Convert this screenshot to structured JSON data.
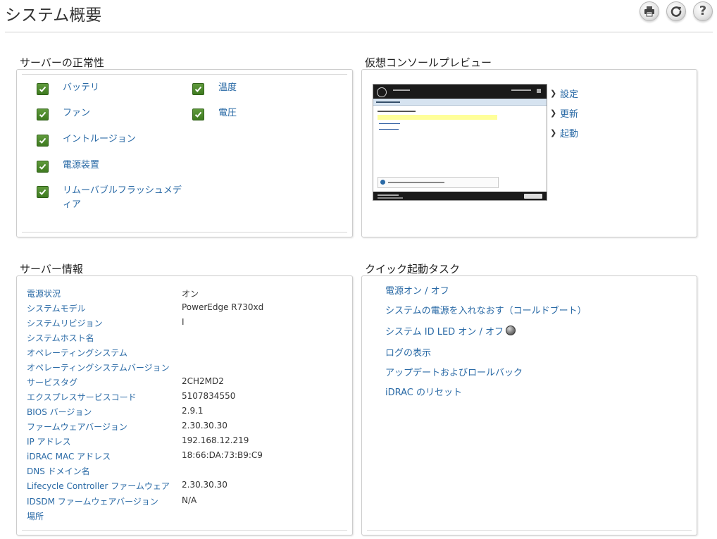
{
  "page": {
    "title": "システム概要"
  },
  "toolbar": {
    "help_label": "?"
  },
  "health": {
    "title": "サーバーの正常性",
    "items": [
      {
        "label": "バッテリ",
        "status": "ok"
      },
      {
        "label": "ファン",
        "status": "ok"
      },
      {
        "label": "イントルージョン",
        "status": "ok"
      },
      {
        "label": "電源装置",
        "status": "ok"
      },
      {
        "label": "リムーバブルフラッシュメディア",
        "status": "ok"
      },
      {
        "label": "温度",
        "status": "ok"
      },
      {
        "label": "電圧",
        "status": "ok"
      }
    ]
  },
  "console": {
    "title": "仮想コンソールプレビュー",
    "actions": [
      {
        "label": "設定"
      },
      {
        "label": "更新"
      },
      {
        "label": "起動"
      }
    ]
  },
  "server_info": {
    "title": "サーバー情報",
    "rows": [
      {
        "label": "電源状況",
        "value": "オン"
      },
      {
        "label": "システムモデル",
        "value": "PowerEdge R730xd"
      },
      {
        "label": "システムリビジョン",
        "value": "I"
      },
      {
        "label": "システムホスト名",
        "value": ""
      },
      {
        "label": "オペレーティングシステム",
        "value": ""
      },
      {
        "label": "オペレーティングシステムバージョン",
        "value": ""
      },
      {
        "label": "サービスタグ",
        "value": "2CH2MD2"
      },
      {
        "label": "エクスプレスサービスコード",
        "value": "5107834550"
      },
      {
        "label": "BIOS バージョン",
        "value": "2.9.1"
      },
      {
        "label": "ファームウェアバージョン",
        "value": "2.30.30.30"
      },
      {
        "label": "IP アドレス",
        "value": "192.168.12.219"
      },
      {
        "label": "iDRAC MAC アドレス",
        "value": "18:66:DA:73:B9:C9"
      },
      {
        "label": "DNS ドメイン名",
        "value": ""
      },
      {
        "label": "Lifecycle Controller ファームウェア",
        "value": "2.30.30.30"
      },
      {
        "label": "IDSDM ファームウェアバージョン",
        "value": "N/A"
      },
      {
        "label": "場所",
        "value": ""
      }
    ]
  },
  "quick_tasks": {
    "title": "クイック起動タスク",
    "items": [
      {
        "label": "電源オン / オフ"
      },
      {
        "label": "システムの電源を入れなおす（コールドブート）"
      },
      {
        "label": "システム ID LED オン / オフ"
      },
      {
        "label": "ログの表示"
      },
      {
        "label": "アップデートおよびロールバック"
      },
      {
        "label": "iDRAC のリセット"
      }
    ]
  },
  "icons": {
    "print": "printer-icon",
    "refresh": "refresh-icon",
    "help": "help-icon",
    "check": "check-icon",
    "chevron": "chevron-right-icon",
    "led": "led-indicator-icon"
  },
  "colors": {
    "link": "#2a6aa6",
    "ok_green": "#4a8a2a",
    "border": "#cccccc"
  }
}
